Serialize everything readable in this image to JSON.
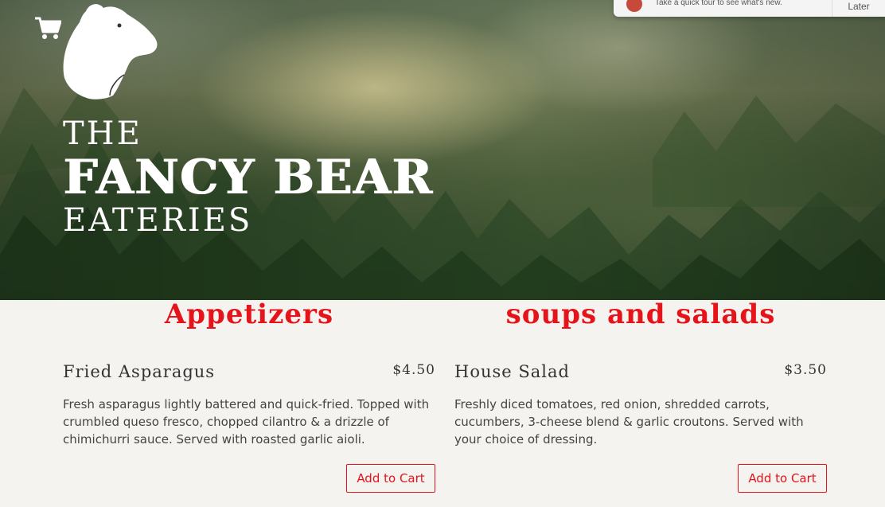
{
  "header": {
    "brand_line1": "THE",
    "brand_line2": "FANCY BEAR",
    "brand_line3": "EATERIES"
  },
  "tour_popup": {
    "text": "Take a quick tour to see what's new.",
    "later_label": "Later"
  },
  "menu": {
    "sections": [
      {
        "title": "Appetizers",
        "item": {
          "name": "Fried Asparagus",
          "price": "$4.50",
          "description": "Fresh asparagus lightly battered and quick-fried. Topped with crumbled queso fresco, chopped cilantro & a drizzle of chimichurri sauce. Served with roasted garlic aioli.",
          "button_label": "Add to Cart"
        }
      },
      {
        "title": "soups and salads",
        "item": {
          "name": "House Salad",
          "price": "$3.50",
          "description": "Freshly diced tomatoes, red onion, shredded carrots, cucumbers, 3-cheese blend & garlic croutons. Served with your choice of dressing.",
          "button_label": "Add to Cart"
        }
      }
    ]
  },
  "colors": {
    "accent": "#e5141b",
    "text": "#333333",
    "background": "#f5f3ef"
  },
  "icons": {
    "cart": "shopping-cart-icon",
    "logo": "bear-head-logo"
  }
}
